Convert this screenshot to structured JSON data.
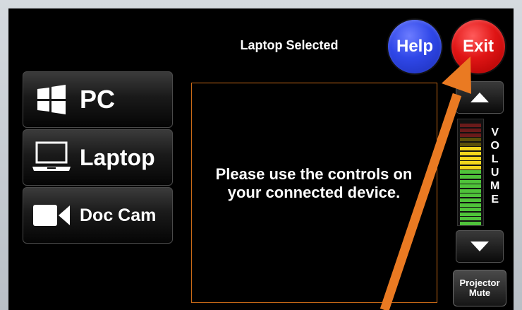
{
  "header": {
    "title": "Laptop Selected"
  },
  "buttons": {
    "help": "Help",
    "exit": "Exit",
    "projector_mute": "Projector Mute"
  },
  "sources": [
    {
      "label": "PC",
      "icon": "windows-logo-icon"
    },
    {
      "label": "Laptop",
      "icon": "laptop-icon"
    },
    {
      "label": "Doc Cam",
      "icon": "video-camera-icon"
    }
  ],
  "message": "Please use the controls on your connected device.",
  "volume": {
    "label": "VOLUME",
    "letters": [
      "V",
      "O",
      "L",
      "U",
      "M",
      "E"
    ],
    "level": 0.75
  },
  "colors": {
    "help": "#2f47e8",
    "exit": "#e01515",
    "accent_border": "#c96a17",
    "arrow": "#ea7a22"
  }
}
